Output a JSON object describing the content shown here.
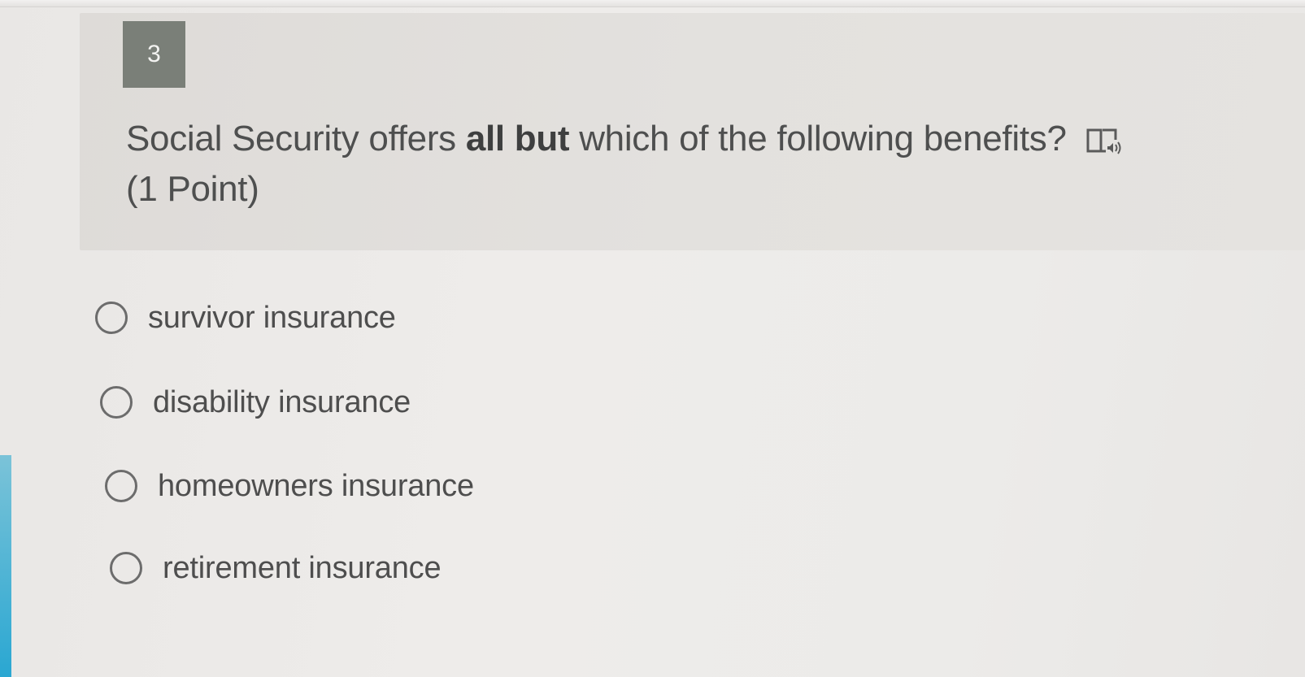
{
  "question": {
    "number": "3",
    "text_before": "Social Security offers ",
    "text_bold": "all but",
    "text_after": " which of the following benefits?",
    "points": "(1 Point)",
    "reader_icon": "immersive-reader-icon"
  },
  "options": [
    {
      "label": "survivor insurance",
      "selected": false
    },
    {
      "label": "disability insurance",
      "selected": false
    },
    {
      "label": "homeowners insurance",
      "selected": false
    },
    {
      "label": "retirement insurance",
      "selected": false
    }
  ],
  "colors": {
    "number_badge": "#7a7f78",
    "card_background": "#e3e1de",
    "left_accent": "#2aa7d2"
  }
}
